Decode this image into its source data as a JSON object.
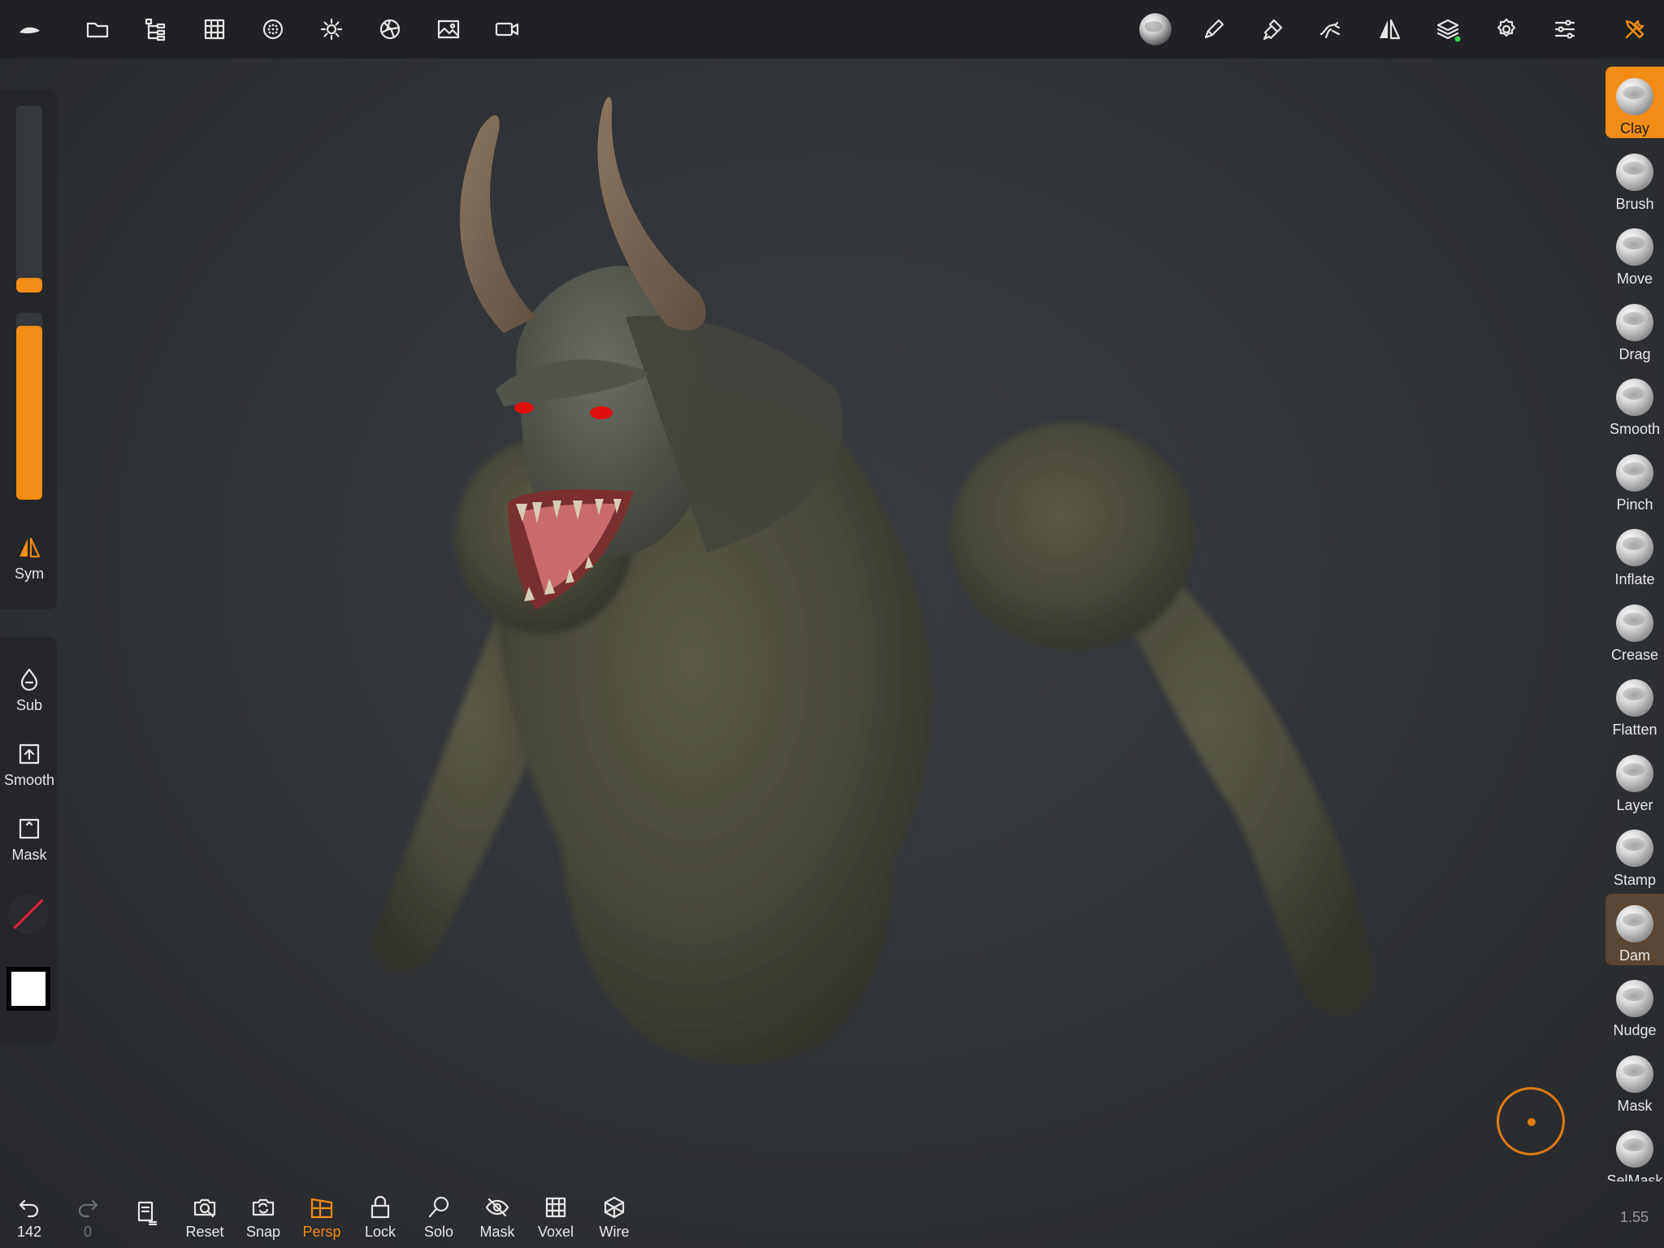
{
  "app": {
    "version": "1.55"
  },
  "topbar": {
    "left_icons": [
      "logo-icon",
      "folder-icon",
      "scene-tree-icon",
      "grid-icon",
      "matcap-icon",
      "light-icon",
      "aperture-icon",
      "image-icon",
      "camera-icon"
    ],
    "right_icons": [
      "material-sphere-icon",
      "pen-icon",
      "paint-icon",
      "pose-icon",
      "symmetry-icon",
      "layers-icon",
      "settings-icon",
      "sliders-icon",
      "tools-icon"
    ]
  },
  "left_panel": {
    "radius_slider": {
      "fraction": 0.08
    },
    "intensity_slider": {
      "fraction": 0.93
    },
    "sym": {
      "label": "Sym"
    },
    "sub": {
      "label": "Sub"
    },
    "smooth": {
      "label": "Smooth"
    },
    "mask": {
      "label": "Mask"
    }
  },
  "brushes": [
    {
      "label": "Clay"
    },
    {
      "label": "Brush"
    },
    {
      "label": "Move"
    },
    {
      "label": "Drag"
    },
    {
      "label": "Smooth"
    },
    {
      "label": "Pinch"
    },
    {
      "label": "Inflate"
    },
    {
      "label": "Crease"
    },
    {
      "label": "Flatten"
    },
    {
      "label": "Layer"
    },
    {
      "label": "Stamp"
    },
    {
      "label": "Dam"
    },
    {
      "label": "Nudge"
    },
    {
      "label": "Mask"
    },
    {
      "label": "SelMask"
    }
  ],
  "bottombar": {
    "undo_count": "142",
    "redo_count": "0",
    "reset": "Reset",
    "snap": "Snap",
    "persp": "Persp",
    "lock": "Lock",
    "solo": "Solo",
    "mask": "Mask",
    "voxel": "Voxel",
    "wire": "Wire"
  },
  "colors": {
    "accent": "#f28c14",
    "eye": "#e01010",
    "model": "#4d4d3e"
  }
}
